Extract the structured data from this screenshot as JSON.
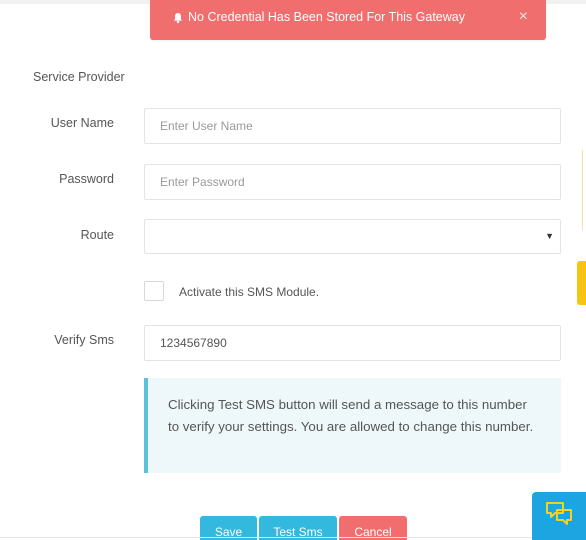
{
  "alert": {
    "message": "No Credential Has Been Stored For This Gateway",
    "close_symbol": "×",
    "color": "#f16e6e"
  },
  "form": {
    "section_title": "Service Provider",
    "username": {
      "label": "User Name",
      "placeholder": "Enter User Name",
      "value": ""
    },
    "password": {
      "label": "Password",
      "placeholder": "Enter Password",
      "value": ""
    },
    "route": {
      "label": "Route",
      "selected": ""
    },
    "activate": {
      "label": "Activate this SMS Module.",
      "checked": false
    },
    "verify": {
      "label": "Verify Sms",
      "value": "1234567890"
    },
    "info_text": "Clicking Test SMS button will send a message to this number to verify your settings. You are allowed to change this number."
  },
  "buttons": {
    "save": "Save",
    "test": "Test Sms",
    "cancel": "Cancel"
  },
  "colors": {
    "primary": "#33b8de",
    "danger": "#f16e6e",
    "info_border": "#5bc0de",
    "info_bg": "#eef8fa",
    "chat_widget": "#1ca5e0",
    "side_tab": "#f6c413"
  },
  "icons": {
    "alert": "bell-icon",
    "close": "close-icon",
    "select": "caret-down-icon",
    "chat": "chat-icon"
  }
}
